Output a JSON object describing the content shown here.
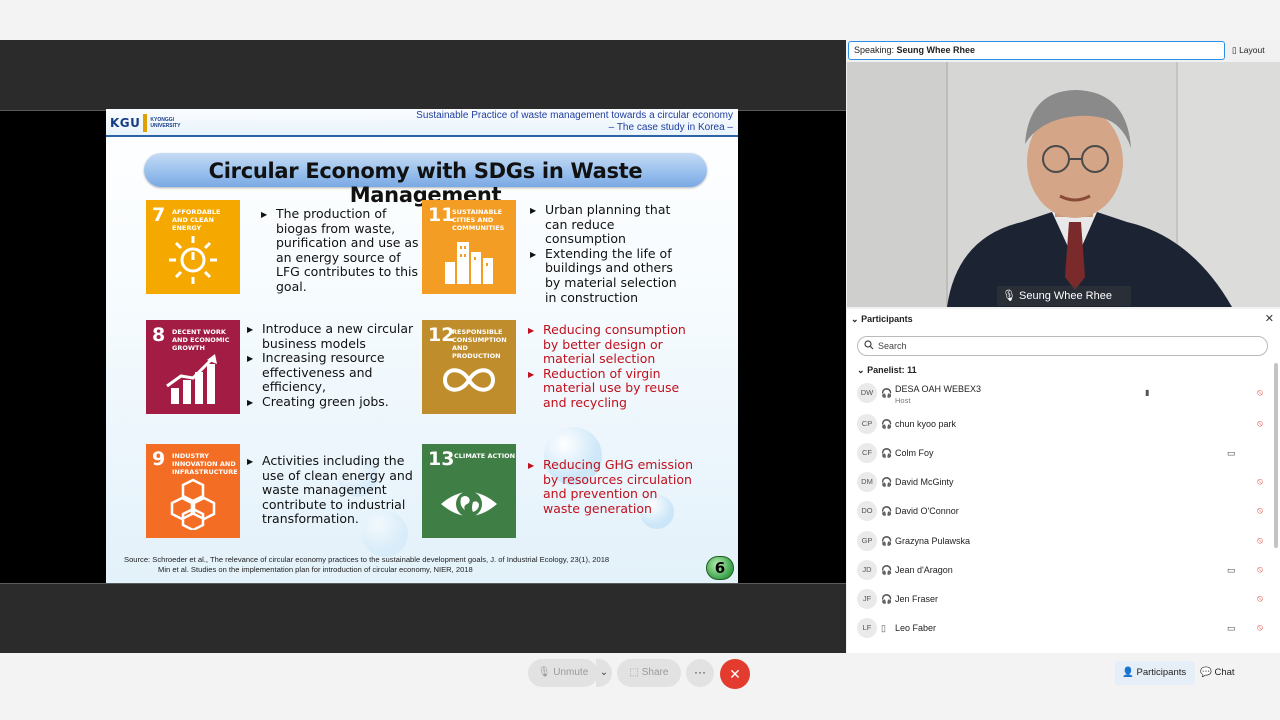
{
  "slide": {
    "logo": {
      "mark": "KGU",
      "text_line1": "KYONGGI",
      "text_line2": "UNIVERSITY"
    },
    "subtitle_line1": "Sustainable Practice of waste management towards a circular economy",
    "subtitle_line2": "– The case study in Korea –",
    "title": "Circular Economy with SDGs in Waste Management",
    "sdgs": [
      {
        "number": "7",
        "label": "AFFORDABLE AND CLEAN ENERGY",
        "color": "#F5A800",
        "icon": "sun-power-icon",
        "bullets": [
          "The production of biogas from waste, purification and use as an energy source of LFG contributes to this goal."
        ]
      },
      {
        "number": "11",
        "label": "SUSTAINABLE CITIES AND COMMUNITIES",
        "color": "#F49D24",
        "icon": "city-buildings-icon",
        "bullets": [
          "Urban planning that can reduce consumption",
          "Extending the life of buildings and others by material selection in construction"
        ]
      },
      {
        "number": "8",
        "label": "DECENT WORK AND ECONOMIC GROWTH",
        "color": "#A31C44",
        "icon": "growth-chart-icon",
        "bullets": [
          "Introduce a new circular business models",
          "Increasing resource effectiveness and efficiency,",
          "Creating green jobs."
        ]
      },
      {
        "number": "12",
        "label": "RESPONSIBLE CONSUMPTION AND PRODUCTION",
        "color": "#BF8D2C",
        "icon": "infinity-loop-icon",
        "bullets": [
          "Reducing consumption by better design or material selection",
          "Reduction of virgin material use by reuse and recycling"
        ]
      },
      {
        "number": "9",
        "label": "INDUSTRY INNOVATION AND INFRASTRUCTURE",
        "color": "#F36E24",
        "icon": "cubes-icon",
        "bullets": [
          "Activities including the use of clean energy and waste management contribute to industrial transformation."
        ]
      },
      {
        "number": "13",
        "label": "CLIMATE ACTION",
        "color": "#3F7E44",
        "icon": "earth-eye-icon",
        "bullets": [
          "Reducing GHG emission by resources circulation and prevention on waste generation"
        ]
      }
    ],
    "source_line1": "Source: Schroeder et al., The relevance of circular economy practices to the sustainable development goals, J. of Industrial Ecology, 23(1), 2018",
    "source_line2": "Min et al. Studies on the implementation plan for introduction of circular economy, NIER, 2018",
    "page_number": "6"
  },
  "speaking": {
    "prefix": "Speaking:",
    "name": "Seung Whee Rhee"
  },
  "layout_label": "Layout",
  "video_name": "Seung Whee Rhee",
  "participants": {
    "header": "Participants",
    "search_placeholder": "Search",
    "panelist_header": "Panelist: 11",
    "list": [
      {
        "initials": "DW",
        "name": "DESA OAH WEBEX3",
        "role": "Host",
        "camera": false
      },
      {
        "initials": "CP",
        "name": "chun kyoo park",
        "role": "",
        "camera": false
      },
      {
        "initials": "CF",
        "name": "Colm Foy",
        "role": "",
        "camera": true
      },
      {
        "initials": "DM",
        "name": "David McGinty",
        "role": "",
        "camera": false
      },
      {
        "initials": "DO",
        "name": "David O'Connor",
        "role": "",
        "camera": false
      },
      {
        "initials": "GP",
        "name": "Grazyna Pulawska",
        "role": "",
        "camera": false
      },
      {
        "initials": "JD",
        "name": "Jean d'Aragon",
        "role": "",
        "camera": true
      },
      {
        "initials": "JF",
        "name": "Jen Fraser",
        "role": "",
        "camera": false
      },
      {
        "initials": "LF",
        "name": "Leo Faber",
        "role": "",
        "camera": true
      }
    ]
  },
  "controls": {
    "unmute_label": "Unmute",
    "share_label": "Share",
    "more_label": "···",
    "end_label": "✕",
    "participants_tab": "Participants",
    "chat_tab": "Chat"
  },
  "colors": {
    "accent": "#2d8ee8",
    "end_call": "#e33b2e",
    "mute_red": "#e0433a"
  }
}
